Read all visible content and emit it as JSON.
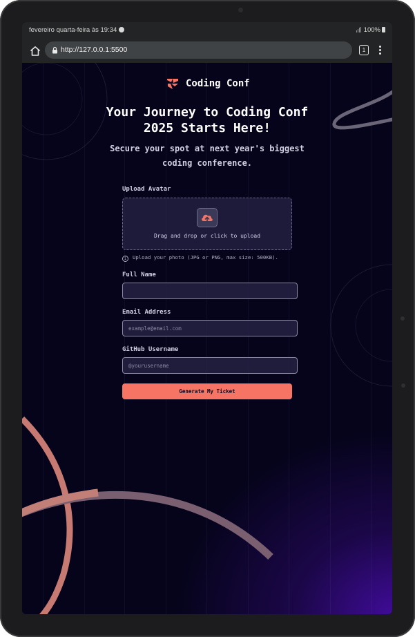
{
  "status_bar": {
    "datetime": "fevereiro quarta-feira às 19:34",
    "battery": "100%"
  },
  "browser": {
    "url": "http://127.0.0.1:5500",
    "tab_count": "1",
    "icons": [
      "home-icon",
      "lock-icon",
      "tabs-icon",
      "more-vert-icon"
    ]
  },
  "site": {
    "brand": "Coding Conf",
    "headline": "Your Journey to Coding Conf 2025 Starts Here!",
    "subheadline": "Secure your spot at next year's biggest coding conference."
  },
  "form": {
    "avatar": {
      "label": "Upload Avatar",
      "dropzone_text": "Drag and drop or click to upload",
      "hint": "Upload your photo (JPG or PNG, max size: 500KB)."
    },
    "full_name": {
      "label": "Full Name",
      "value": "",
      "placeholder": ""
    },
    "email": {
      "label": "Email Address",
      "value": "",
      "placeholder": "example@email.com"
    },
    "github": {
      "label": "GitHub Username",
      "value": "",
      "placeholder": "@yourusername"
    },
    "submit_label": "Generate My Ticket"
  },
  "colors": {
    "accent": "#f57463",
    "background": "#05041a",
    "glow": "#430ca0",
    "text_primary": "#ffffff",
    "text_secondary": "#d1d0e3"
  }
}
